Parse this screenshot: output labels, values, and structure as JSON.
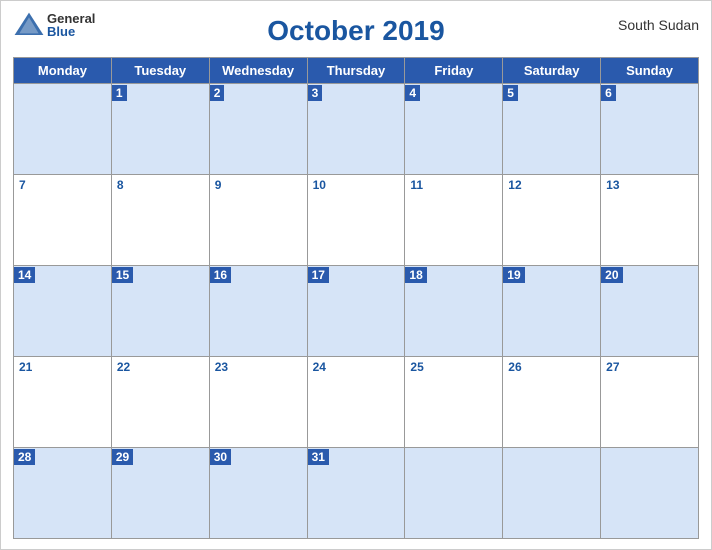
{
  "header": {
    "logo_general": "General",
    "logo_blue": "Blue",
    "month_year": "October 2019",
    "country": "South Sudan"
  },
  "days_of_week": [
    "Monday",
    "Tuesday",
    "Wednesday",
    "Thursday",
    "Friday",
    "Saturday",
    "Sunday"
  ],
  "weeks": [
    {
      "shaded": true,
      "days": [
        {
          "date": "",
          "empty": true
        },
        {
          "date": "1"
        },
        {
          "date": "2"
        },
        {
          "date": "3"
        },
        {
          "date": "4"
        },
        {
          "date": "5"
        },
        {
          "date": "6"
        }
      ]
    },
    {
      "shaded": false,
      "days": [
        {
          "date": "7"
        },
        {
          "date": "8"
        },
        {
          "date": "9"
        },
        {
          "date": "10"
        },
        {
          "date": "11"
        },
        {
          "date": "12"
        },
        {
          "date": "13"
        }
      ]
    },
    {
      "shaded": true,
      "days": [
        {
          "date": "14"
        },
        {
          "date": "15"
        },
        {
          "date": "16"
        },
        {
          "date": "17"
        },
        {
          "date": "18"
        },
        {
          "date": "19"
        },
        {
          "date": "20"
        }
      ]
    },
    {
      "shaded": false,
      "days": [
        {
          "date": "21"
        },
        {
          "date": "22"
        },
        {
          "date": "23"
        },
        {
          "date": "24"
        },
        {
          "date": "25"
        },
        {
          "date": "26"
        },
        {
          "date": "27"
        }
      ]
    },
    {
      "shaded": true,
      "days": [
        {
          "date": "28"
        },
        {
          "date": "29"
        },
        {
          "date": "30"
        },
        {
          "date": "31"
        },
        {
          "date": "",
          "empty": true
        },
        {
          "date": "",
          "empty": true
        },
        {
          "date": "",
          "empty": true
        }
      ]
    }
  ],
  "colors": {
    "header_bg": "#2a5aad",
    "accent": "#1a56a0",
    "shaded_row": "#d6e4f7",
    "border": "#999"
  }
}
